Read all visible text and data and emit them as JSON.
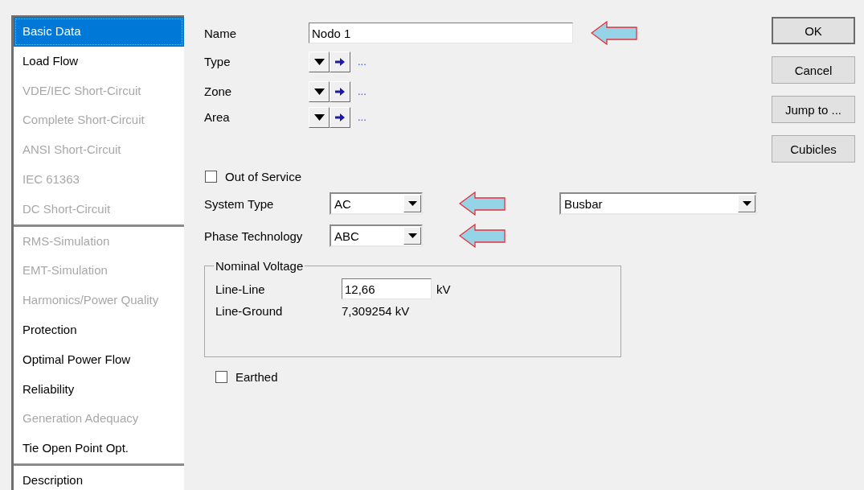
{
  "sidebar": {
    "groups": [
      {
        "items": [
          {
            "label": "Basic Data",
            "selected": true,
            "disabled": false
          },
          {
            "label": "Load Flow",
            "selected": false,
            "disabled": false
          },
          {
            "label": "VDE/IEC Short-Circuit",
            "selected": false,
            "disabled": true
          },
          {
            "label": "Complete Short-Circuit",
            "selected": false,
            "disabled": true
          },
          {
            "label": "ANSI Short-Circuit",
            "selected": false,
            "disabled": true
          },
          {
            "label": "IEC 61363",
            "selected": false,
            "disabled": true
          },
          {
            "label": "DC Short-Circuit",
            "selected": false,
            "disabled": true
          }
        ]
      },
      {
        "items": [
          {
            "label": "RMS-Simulation",
            "selected": false,
            "disabled": true
          },
          {
            "label": "EMT-Simulation",
            "selected": false,
            "disabled": true
          },
          {
            "label": "Harmonics/Power Quality",
            "selected": false,
            "disabled": true
          },
          {
            "label": "Protection",
            "selected": false,
            "disabled": false
          },
          {
            "label": "Optimal Power Flow",
            "selected": false,
            "disabled": false
          },
          {
            "label": "Reliability",
            "selected": false,
            "disabled": false
          },
          {
            "label": "Generation Adequacy",
            "selected": false,
            "disabled": true
          },
          {
            "label": "Tie Open Point Opt.",
            "selected": false,
            "disabled": false
          }
        ]
      },
      {
        "items": [
          {
            "label": "Description",
            "selected": false,
            "disabled": false
          }
        ]
      }
    ]
  },
  "form": {
    "name": {
      "label": "Name",
      "value": "Nodo 1",
      "highlighted": true
    },
    "references": [
      {
        "label": "Type",
        "more": "..."
      },
      {
        "label": "Zone",
        "more": "..."
      },
      {
        "label": "Area",
        "more": "..."
      }
    ],
    "out_of_service": {
      "label": "Out of Service",
      "checked": false
    },
    "system_type": {
      "label": "System Type",
      "value": "AC",
      "highlighted": true
    },
    "usage": {
      "value": "Busbar"
    },
    "phase_technology": {
      "label": "Phase Technology",
      "value": "ABC",
      "highlighted": true
    },
    "nominal_voltage": {
      "title": "Nominal Voltage",
      "line_line": {
        "label": "Line-Line",
        "value": "12,66",
        "unit": "kV"
      },
      "line_ground": {
        "label": "Line-Ground",
        "value": "7,309254 kV"
      }
    },
    "earthed": {
      "label": "Earthed",
      "checked": false
    }
  },
  "buttons": [
    {
      "label": "OK",
      "default": true
    },
    {
      "label": "Cancel",
      "default": false
    },
    {
      "label": "Jump to ...",
      "default": false
    },
    {
      "label": "Cubicles",
      "default": false
    }
  ]
}
